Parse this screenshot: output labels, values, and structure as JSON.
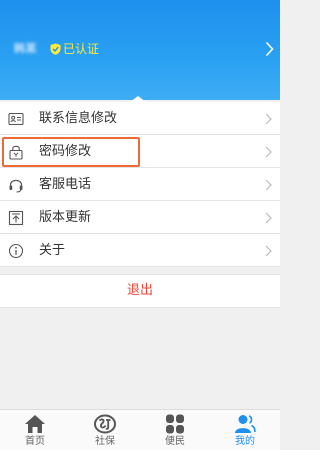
{
  "header": {
    "user_name": "韩某",
    "verified_label": "已认证",
    "verified_icon": "shield-check-icon",
    "chevron_icon": "chevron-right-icon"
  },
  "menu": {
    "items": [
      {
        "label": "联系信息修改",
        "icon": "contact-card-icon"
      },
      {
        "label": "密码修改",
        "icon": "lock-icon",
        "highlighted": true
      },
      {
        "label": "客服电话",
        "icon": "headset-icon"
      },
      {
        "label": "版本更新",
        "icon": "upload-icon"
      },
      {
        "label": "关于",
        "icon": "info-icon"
      }
    ]
  },
  "logout_label": "退出",
  "bottom_nav": {
    "items": [
      {
        "label": "首页",
        "icon": "home-icon",
        "active": false
      },
      {
        "label": "社保",
        "icon": "social-security-icon",
        "active": false
      },
      {
        "label": "便民",
        "icon": "grid-icon",
        "active": false
      },
      {
        "label": "我的",
        "icon": "user-icon",
        "active": true
      }
    ]
  },
  "colors": {
    "header_blue": "#1e90ee",
    "verified_yellow": "#ffea3a",
    "highlight_orange": "#f06a35",
    "logout_red": "#e8483a",
    "active_tab": "#1e90ee",
    "inactive_tab": "#666666"
  }
}
